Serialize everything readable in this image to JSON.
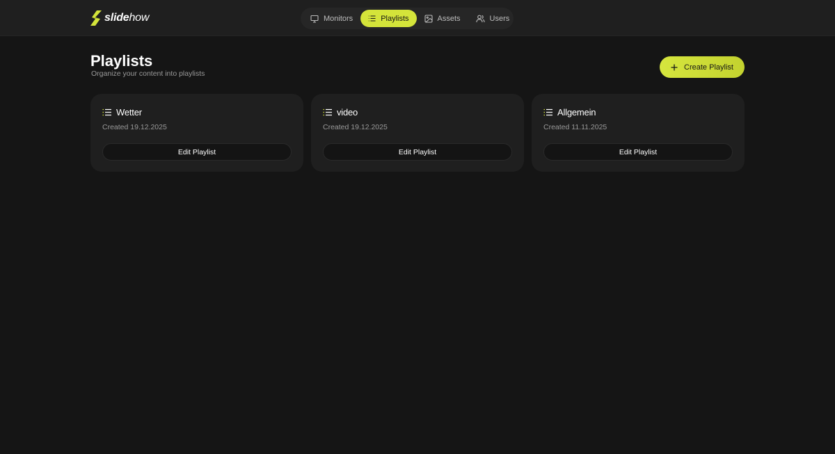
{
  "brand": {
    "bold": "slide",
    "thin": "how"
  },
  "nav": {
    "items": [
      {
        "label": "Monitors",
        "icon": "monitor-icon",
        "active": false
      },
      {
        "label": "Playlists",
        "icon": "list-icon",
        "active": true
      },
      {
        "label": "Assets",
        "icon": "image-icon",
        "active": false
      },
      {
        "label": "Users",
        "icon": "users-icon",
        "active": false
      }
    ]
  },
  "header": {
    "title": "Playlists",
    "subtitle": "Organize your content into playlists",
    "create_label": "Create Playlist"
  },
  "playlists": [
    {
      "name": "Wetter",
      "created": "Created 19.12.2025",
      "edit_label": "Edit Playlist"
    },
    {
      "name": "video",
      "created": "Created 19.12.2025",
      "edit_label": "Edit Playlist"
    },
    {
      "name": "Allgemein",
      "created": "Created 11.11.2025",
      "edit_label": "Edit Playlist"
    }
  ],
  "colors": {
    "accent": "#d4e43a",
    "background": "#151515",
    "surface": "#1f1f1f",
    "muted_text": "#9a9a9a"
  }
}
